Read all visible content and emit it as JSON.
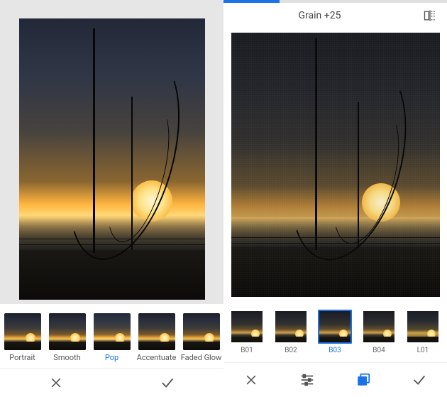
{
  "left": {
    "filters": [
      {
        "label": "Portrait",
        "active": false
      },
      {
        "label": "Smooth",
        "active": false
      },
      {
        "label": "Pop",
        "active": true
      },
      {
        "label": "Accentuate",
        "active": false
      },
      {
        "label": "Faded Glow",
        "active": false
      }
    ],
    "actions": {
      "cancel": "cancel",
      "confirm": "confirm"
    }
  },
  "right": {
    "progress_percent": 25,
    "setting_label": "Grain +25",
    "filters": [
      {
        "label": "B01",
        "active": false
      },
      {
        "label": "B02",
        "active": false
      },
      {
        "label": "B03",
        "active": true
      },
      {
        "label": "B04",
        "active": false
      },
      {
        "label": "L01",
        "active": false
      }
    ],
    "toolbar": {
      "cancel": "cancel",
      "tune": "tune",
      "styles": "styles",
      "confirm": "confirm"
    }
  }
}
